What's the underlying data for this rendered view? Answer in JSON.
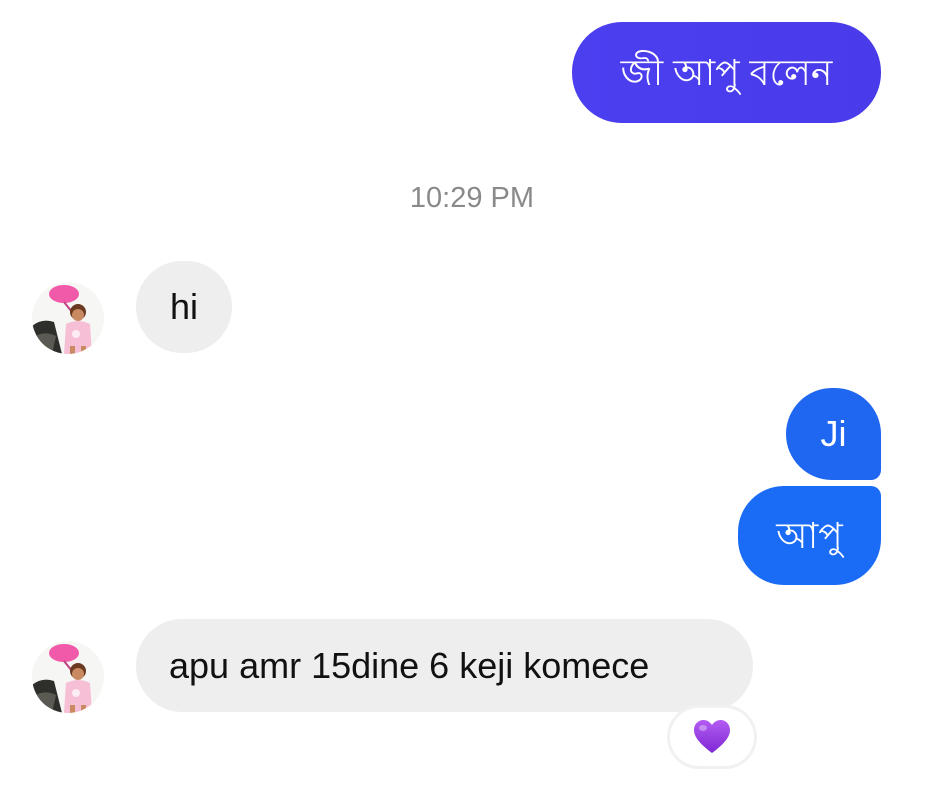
{
  "messages": {
    "sent_1": "জী আপু বলেন",
    "timestamp": "10:29 PM",
    "received_1": "hi",
    "sent_2": "Ji",
    "sent_3": "আপু",
    "received_2": "apu amr 15dine 6 keji komece"
  },
  "reaction": {
    "icon": "purple-heart-icon",
    "color": "#9b3de6"
  },
  "colors": {
    "sent_bubble_dark": "#4a3bea",
    "sent_bubble_blue": "#1a6bf5",
    "received_bubble": "#eeeeee"
  }
}
